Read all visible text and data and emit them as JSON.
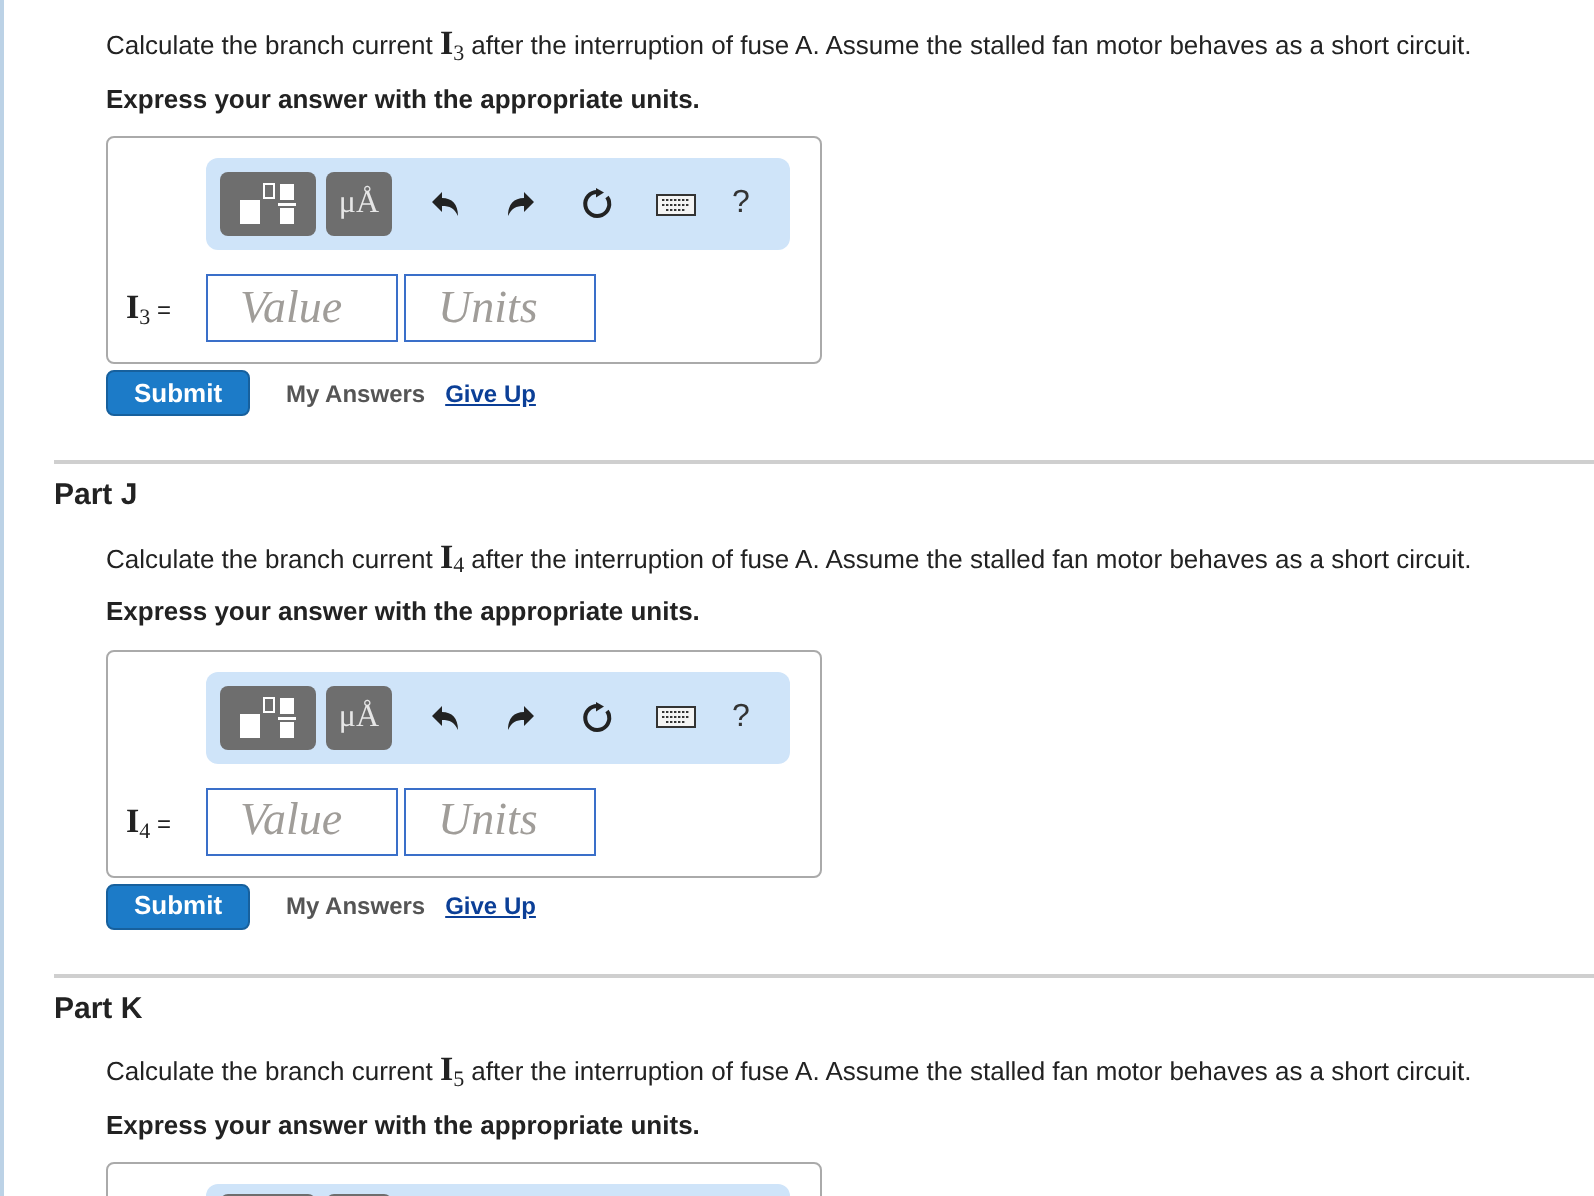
{
  "parts": [
    {
      "kind": "full",
      "question": "Calculate the branch current **I**$_{3}$ after the interruption of fuse A. Assume the stalled fan motor behaves as a short circuit.",
      "instruction": "Express your answer with the appropriate units.",
      "units_button": "μÅ",
      "help": "?",
      "variable": "**I**$_{3}$ =",
      "value_placeholder": "Value",
      "units_placeholder": "Units",
      "submit": "Submit",
      "my_answers": "My Answers",
      "give_up": "Give Up"
    },
    {
      "kind": "full",
      "title": "Part J",
      "question": "Calculate the branch current **I**$_{4}$ after the interruption of fuse A. Assume the stalled fan motor behaves as a short circuit.",
      "instruction": "Express your answer with the appropriate units.",
      "units_button": "μÅ",
      "help": "?",
      "variable": "**I**$_{4}$ =",
      "value_placeholder": "Value",
      "units_placeholder": "Units",
      "submit": "Submit",
      "my_answers": "My Answers",
      "give_up": "Give Up"
    },
    {
      "kind": "cut",
      "title": "Part K",
      "question": "Calculate the branch current **I**$_{5}$ after the interruption of fuse A. Assume the stalled fan motor behaves as a short circuit.",
      "instruction": "Express your answer with the appropriate units."
    }
  ]
}
